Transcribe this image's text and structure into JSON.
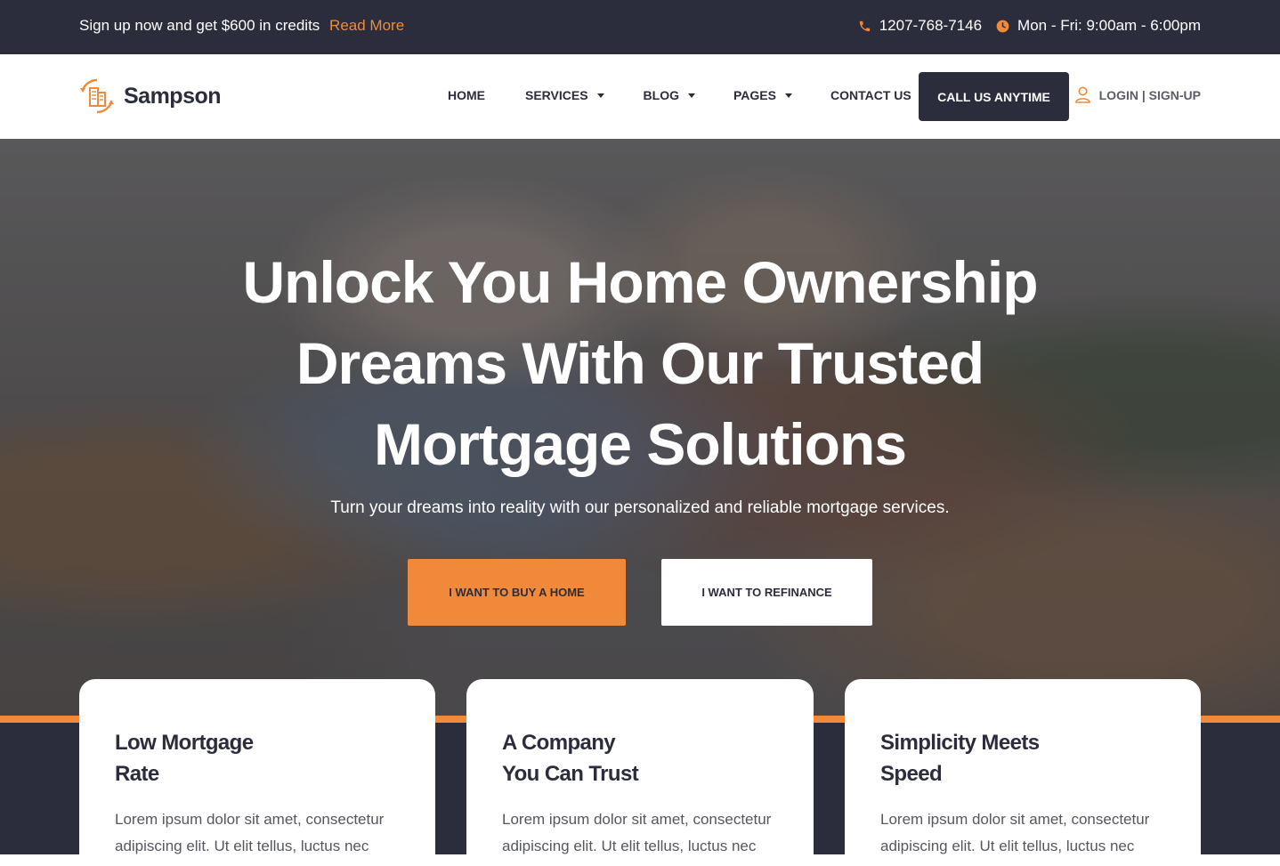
{
  "topbar": {
    "promo_text": "Sign up now and get $600 in credits",
    "promo_link": "Read More",
    "phone": "1207-768-7146",
    "hours": "Mon - Fri: 9:00am - 6:00pm"
  },
  "brand": {
    "name": "Sampson"
  },
  "nav": {
    "items": [
      {
        "label": "HOME",
        "dropdown": false
      },
      {
        "label": "SERVICES",
        "dropdown": true
      },
      {
        "label": "BLOG",
        "dropdown": true
      },
      {
        "label": "PAGES",
        "dropdown": true
      },
      {
        "label": "CONTACT US",
        "dropdown": false
      }
    ],
    "cta": "CALL US ANYTIME",
    "login": "LOGIN | SIGN-UP"
  },
  "hero": {
    "title": "Unlock You Home Ownership Dreams With Our Trusted Mortgage Solutions",
    "subtitle": "Turn your dreams into reality with our personalized and reliable mortgage services.",
    "buy_button": "I WANT TO BUY A HOME",
    "refinance_button": "I WANT TO REFINANCE"
  },
  "features": [
    {
      "title_line1": "Low Mortgage",
      "title_line2": "Rate",
      "text": "Lorem ipsum dolor sit amet, consectetur adipiscing elit. Ut elit tellus, luctus nec"
    },
    {
      "title_line1": "A Company",
      "title_line2": "You Can Trust",
      "text": "Lorem ipsum dolor sit amet, consectetur adipiscing elit. Ut elit tellus, luctus nec"
    },
    {
      "title_line1": "Simplicity Meets",
      "title_line2": "Speed",
      "text": "Lorem ipsum dolor sit amet, consectetur adipiscing elit. Ut elit tellus, luctus nec"
    }
  ],
  "colors": {
    "accent": "#f08a3a",
    "dark": "#2b2d3c",
    "white": "#ffffff"
  }
}
